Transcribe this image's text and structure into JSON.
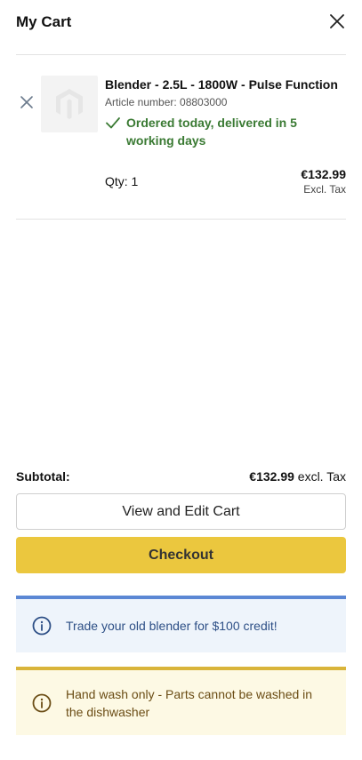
{
  "header": {
    "title": "My Cart",
    "close_icon": "close-icon"
  },
  "item": {
    "name": "Blender - 2.5L - 1800W - Pulse Function",
    "article": "Article number: 08803000",
    "delivery": "Ordered today, delivered in 5 working days",
    "qty": "Qty: 1",
    "price": "€132.99",
    "tax_note": "Excl. Tax",
    "remove_icon": "remove-x-icon",
    "thumbnail_icon": "magento-logo-placeholder-icon"
  },
  "summary": {
    "subtotal_label": "Subtotal:",
    "subtotal_value": "€132.99",
    "subtotal_suffix": "excl. Tax"
  },
  "buttons": {
    "edit_label": "View and Edit Cart",
    "checkout_label": "Checkout"
  },
  "notices": {
    "info_text": "Trade your old blender for $100 credit!",
    "warn_text": "Hand wash only - Parts cannot be washed in the dishwasher"
  },
  "colors": {
    "checkout_bg": "#ebc73e",
    "delivery_green": "#3a7a33",
    "info_border": "#5b87d4",
    "info_bg": "#eef4fb",
    "warn_border": "#d9b43a",
    "warn_bg": "#fdf9e4"
  }
}
